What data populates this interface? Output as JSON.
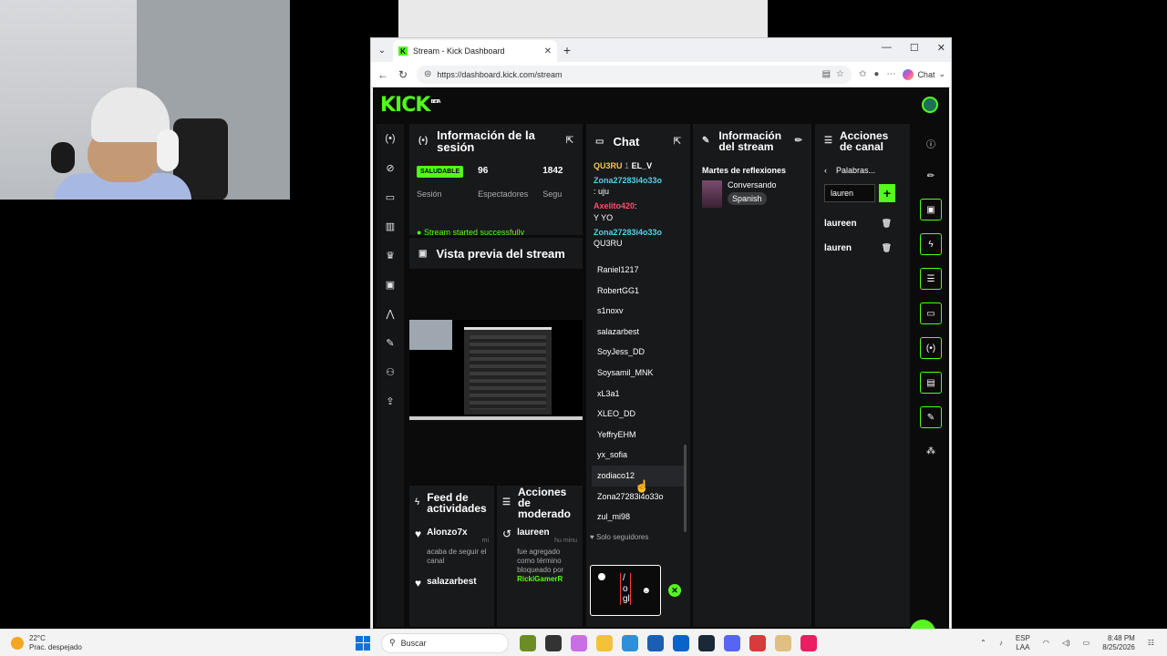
{
  "browser": {
    "tab_title": "Stream - Kick Dashboard",
    "url": "https://dashboard.kick.com/stream",
    "chat_label": "Chat"
  },
  "kick": {
    "logo": "KICK",
    "logo_sup": "BETA"
  },
  "session": {
    "title": "Información de la sesión",
    "status": "SALUDABLE",
    "status_label": "Sesión",
    "viewers_value": "96",
    "viewers_label": "Espectadores",
    "followers_value": "1842",
    "followers_label": "Segu",
    "started": "Stream started successfully"
  },
  "preview": {
    "title": "Vista previa del stream"
  },
  "feed": {
    "title": "Feed de actividades",
    "items": [
      {
        "name": "Alonzo7x",
        "time": "mi",
        "desc": "acaba de seguir el canal"
      },
      {
        "name": "salazarbest",
        "time": "",
        "desc": ""
      }
    ]
  },
  "mod": {
    "title": "Acciones de moderado",
    "item_name": "laureen",
    "item_time": "hu minu",
    "item_desc": "fue agregado como término bloqueado por",
    "item_by": "RickiGamerR"
  },
  "chat": {
    "title": "Chat",
    "messages": [
      {
        "user": "QU3RU",
        "badge": "1",
        "user2": "EL_V"
      },
      {
        "user": "Zona27283i4o33o",
        "text": ": uju"
      },
      {
        "user": "Axelito420",
        "text": "Y YO"
      },
      {
        "user": "Zona27283i4o33o",
        "text": "QU3RU"
      }
    ],
    "users": [
      "Raniel1217",
      "RobertGG1",
      "s1noxv",
      "salazarbest",
      "SoyJess_DD",
      "Soysamil_MNK",
      "xL3a1",
      "XLEO_DD",
      "YeffryEHM",
      "yx_sofia",
      "zodiaco12",
      "Zona27283i4o33o",
      "zul_mi98"
    ],
    "followers_only": "Solo seguidores",
    "input_text": "/ o gl"
  },
  "stream_info": {
    "title": "Información del stream",
    "stream_title": "Martes de reflexiones",
    "category": "Conversando",
    "tag": "Spanish"
  },
  "actions": {
    "title": "Acciones de canal",
    "back_label": "Palabras...",
    "input_value": "lauren",
    "words": [
      "laureen",
      "lauren"
    ]
  },
  "taskbar": {
    "temp": "22°C",
    "weather": "Prac. despejado",
    "search": "Buscar",
    "lang1": "ESP",
    "lang2": "LAA",
    "time": "8:48 PM",
    "date": "8/25/2026"
  }
}
